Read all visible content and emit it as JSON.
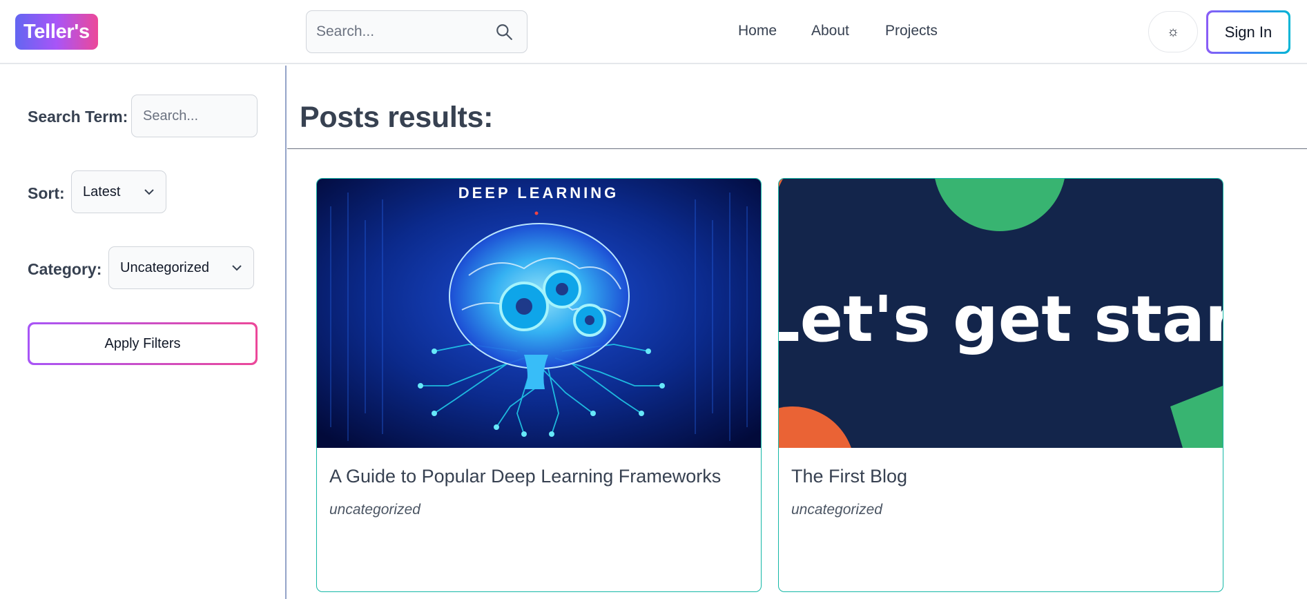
{
  "header": {
    "logo": "Teller's",
    "search_placeholder": "Search...",
    "nav": [
      "Home",
      "About",
      "Projects"
    ],
    "theme_icon": "sun-icon",
    "theme_glyph": "☼",
    "sign_in": "Sign In"
  },
  "sidebar": {
    "search_label": "Search Term:",
    "search_placeholder": "Search...",
    "sort_label": "Sort:",
    "sort_value": "Latest",
    "category_label": "Category:",
    "category_value": "Uncategorized",
    "apply_label": "Apply Filters"
  },
  "main": {
    "title": "Posts results:",
    "posts": [
      {
        "title": "A Guide to Popular Deep Learning Frameworks",
        "category": "uncategorized",
        "image_text": "DEEP LEARNING"
      },
      {
        "title": "The First Blog",
        "category": "uncategorized",
        "image_text": "Let's get started"
      }
    ]
  },
  "colors": {
    "card_border": "#14b8a6",
    "card2_bg": "#13254b",
    "green": "#38b471",
    "orange": "#ea6335"
  }
}
